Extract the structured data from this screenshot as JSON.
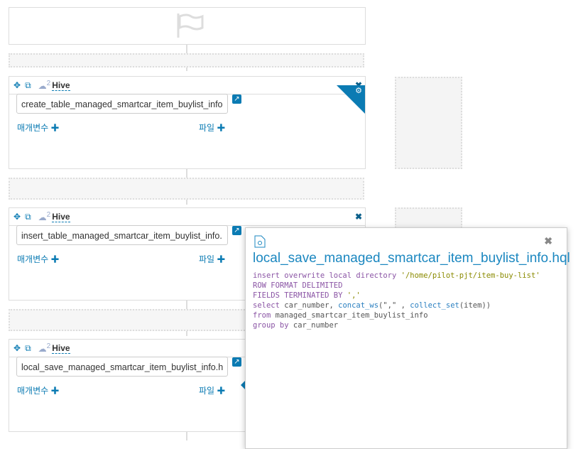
{
  "start": {
    "icon": "flag-icon"
  },
  "cards": [
    {
      "type": "Hive",
      "count": "2",
      "file": "create_table_managed_smartcar_item_buylist_info",
      "params_label": "매개변수",
      "files_label": "파일"
    },
    {
      "type": "Hive",
      "count": "2",
      "file": "insert_table_managed_smartcar_item_buylist_info.",
      "params_label": "매개변수",
      "files_label": "파일"
    },
    {
      "type": "Hive",
      "count": "2",
      "file": "local_save_managed_smartcar_item_buylist_info.h",
      "params_label": "매개변수",
      "files_label": "파일"
    }
  ],
  "popover": {
    "title": "local_save_managed_smartcar_item_buylist_info.hql",
    "code": {
      "l1a": "insert overwrite local directory ",
      "l1b": "'/home/pilot-pjt/item-buy-list'",
      "l2": "ROW FORMAT DELIMITED",
      "l3a": "FIELDS TERMINATED BY ",
      "l3b": "','",
      "l4a": "select",
      "l4b": " car_number, ",
      "l4c": "concat_ws",
      "l4d": "(\",\" , ",
      "l4e": "collect_set",
      "l4f": "(item))",
      "l5a": "from",
      "l5b": " managed_smartcar_item_buylist_info",
      "l6a": "group by",
      "l6b": " car_number"
    }
  }
}
